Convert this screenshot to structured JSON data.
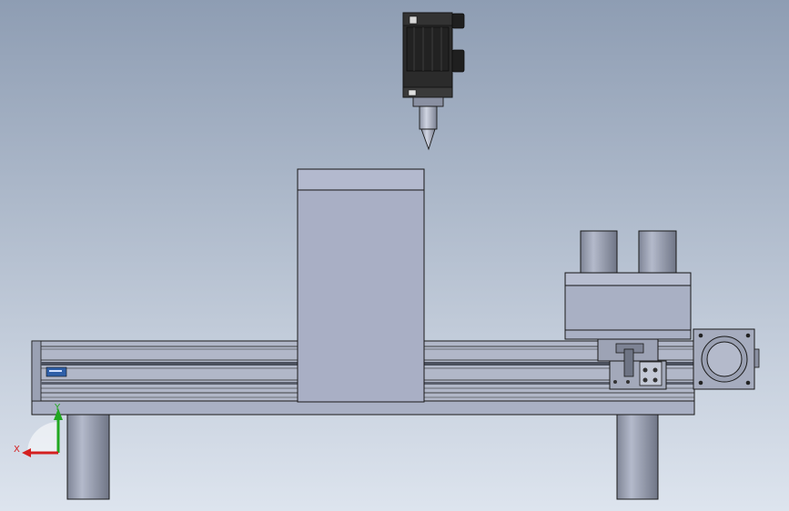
{
  "viewport": {
    "background_top": "#8e9db3",
    "background_bottom": "#dde4ee"
  },
  "triad": {
    "x_label": "X",
    "y_label": "Y",
    "x_color": "#d42020",
    "y_color": "#21a821"
  },
  "model": {
    "steel_color": "#a9b0c4",
    "motor_color": "#2b2b2b",
    "outline_color": "#1a1a1a"
  }
}
